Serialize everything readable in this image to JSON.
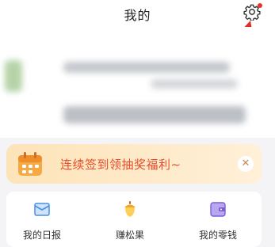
{
  "header": {
    "title": "我的",
    "settings_icon": "gear-icon",
    "notification_dot_color": "#e8302d"
  },
  "annotation": {
    "arrow_color": "#e52a2a"
  },
  "banner": {
    "icon": "calendar-icon",
    "text": "连续签到领抽奖福利~",
    "close_icon": "close-icon",
    "close_symbol": "✕",
    "text_color": "#ea4c2b"
  },
  "shortcuts": [
    {
      "label": "我的日报",
      "icon": "envelope-icon"
    },
    {
      "label": "赚松果",
      "icon": "acorn-icon"
    },
    {
      "label": "我的零钱",
      "icon": "wallet-icon"
    }
  ]
}
